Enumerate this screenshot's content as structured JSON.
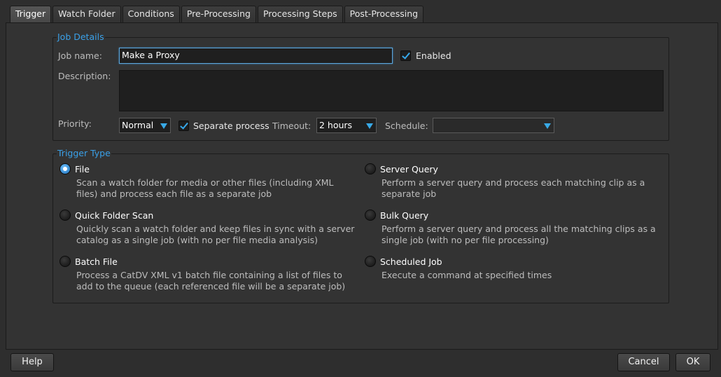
{
  "tabs": [
    "Trigger",
    "Watch Folder",
    "Conditions",
    "Pre-Processing",
    "Processing Steps",
    "Post-Processing"
  ],
  "job_details": {
    "title": "Job Details",
    "job_name_label": "Job name:",
    "job_name_value": "Make a Proxy",
    "enabled_label": "Enabled",
    "description_label": "Description:",
    "description_value": "",
    "priority_label": "Priority:",
    "priority_value": "Normal",
    "separate_process_label": "Separate process",
    "timeout_label": "Timeout:",
    "timeout_value": "2 hours",
    "schedule_label": "Schedule:",
    "schedule_value": ""
  },
  "trigger_type": {
    "title": "Trigger Type",
    "options": [
      {
        "title": "File",
        "desc": "Scan a watch folder for media or other files (including XML files) and process each file as a separate job"
      },
      {
        "title": "Server Query",
        "desc": "Perform a server query and process each matching clip as a separate job"
      },
      {
        "title": "Quick Folder Scan",
        "desc": "Quickly scan a watch folder and keep files in sync with a server catalog as a single job (with no per file media analysis)"
      },
      {
        "title": "Bulk Query",
        "desc": "Perform a server query and process all the matching clips as a single job (with no per file processing)"
      },
      {
        "title": "Batch File",
        "desc": "Process a CatDV XML v1 batch file containing a list of files to add to the queue (each referenced file will be a separate job)"
      },
      {
        "title": "Scheduled Job",
        "desc": "Execute a command at specified times"
      }
    ]
  },
  "buttons": {
    "help": "Help",
    "cancel": "Cancel",
    "ok": "OK"
  },
  "colors": {
    "accent": "#3aa0e8",
    "background": "#2e2e2e"
  }
}
